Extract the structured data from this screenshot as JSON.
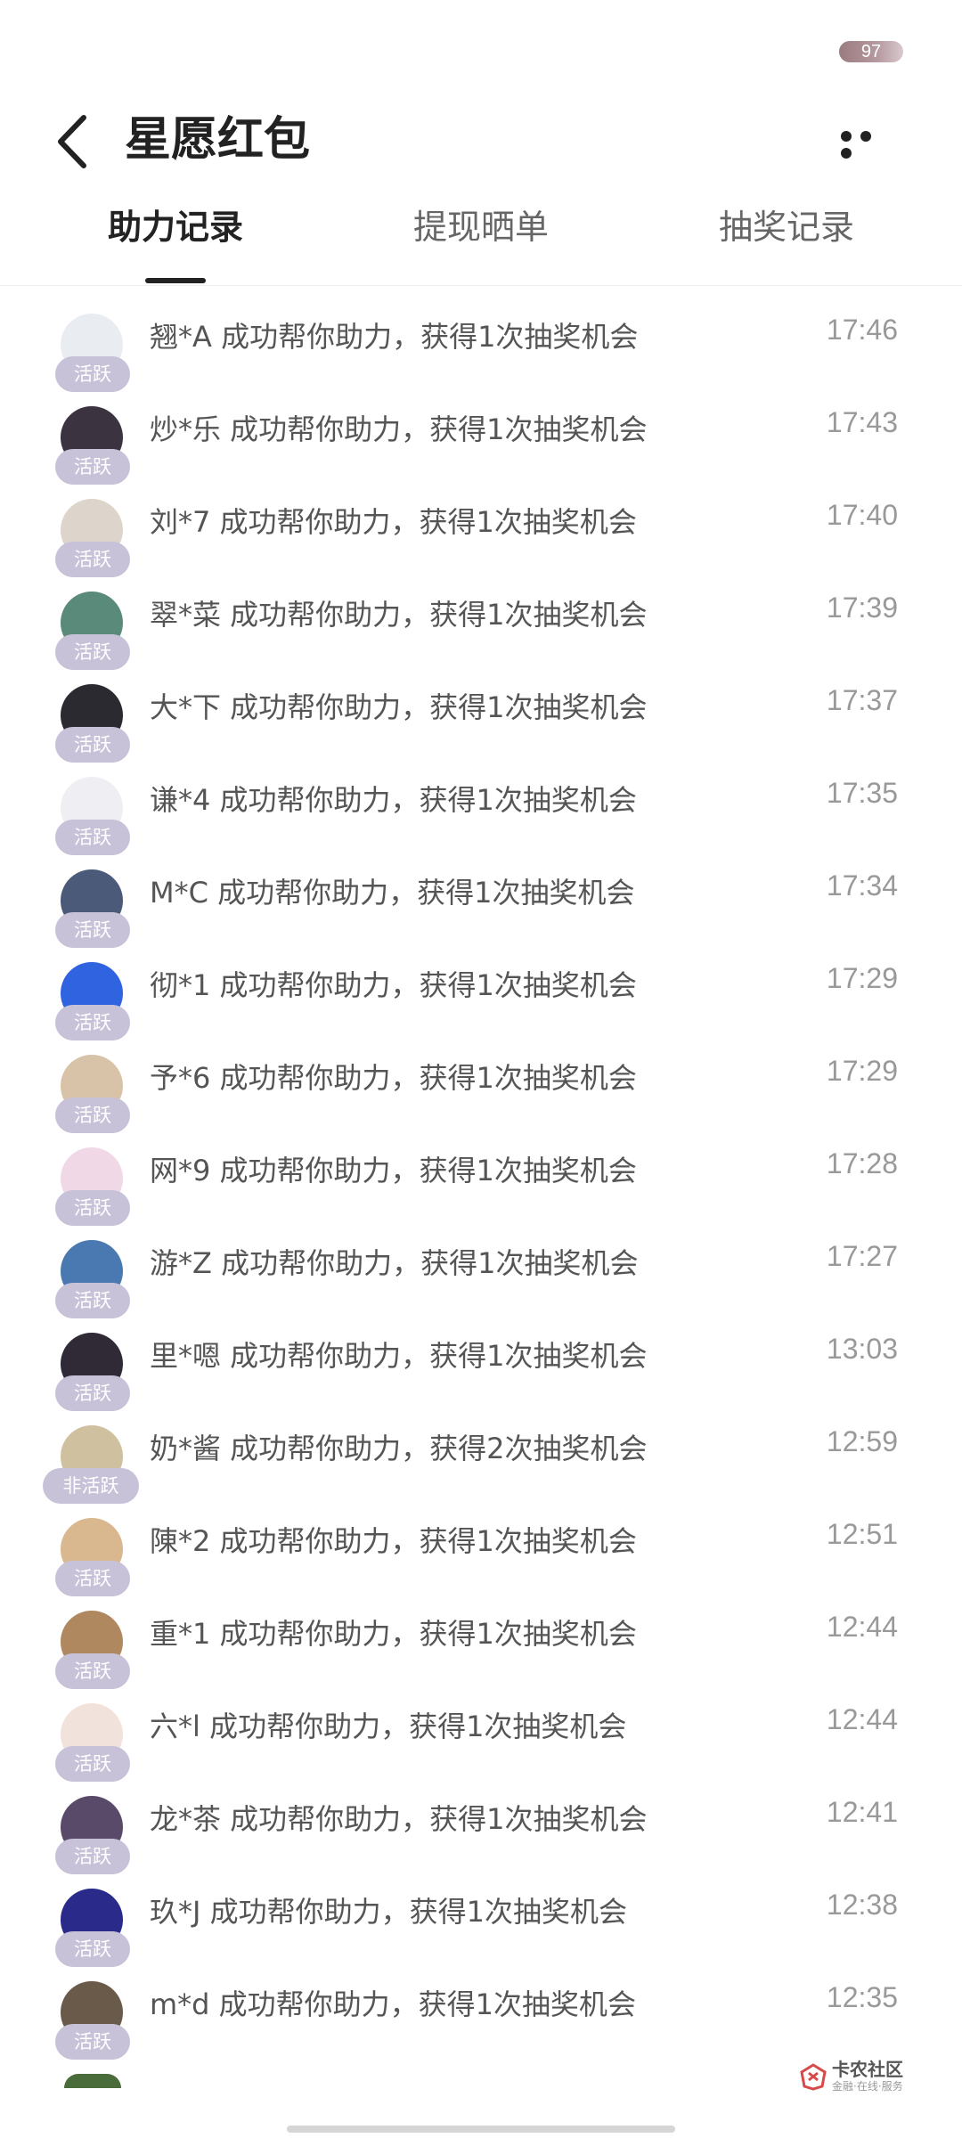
{
  "status_bar": {
    "battery": "97"
  },
  "header": {
    "title": "星愿红包"
  },
  "tabs": [
    {
      "label": "助力记录",
      "active": true
    },
    {
      "label": "提现晒单",
      "active": false
    },
    {
      "label": "抽奖记录",
      "active": false
    }
  ],
  "records": [
    {
      "text": "翘*A 成功帮你助力，获得1次抽奖机会",
      "time": "17:46",
      "badge": "活跃"
    },
    {
      "text": "炒*乐 成功帮你助力，获得1次抽奖机会",
      "time": "17:43",
      "badge": "活跃"
    },
    {
      "text": "刘*7 成功帮你助力，获得1次抽奖机会",
      "time": "17:40",
      "badge": "活跃"
    },
    {
      "text": "翠*菜 成功帮你助力，获得1次抽奖机会",
      "time": "17:39",
      "badge": "活跃"
    },
    {
      "text": "大*下 成功帮你助力，获得1次抽奖机会",
      "time": "17:37",
      "badge": "活跃"
    },
    {
      "text": "谦*4 成功帮你助力，获得1次抽奖机会",
      "time": "17:35",
      "badge": "活跃"
    },
    {
      "text": "M*C 成功帮你助力，获得1次抽奖机会",
      "time": "17:34",
      "badge": "活跃"
    },
    {
      "text": "彻*1 成功帮你助力，获得1次抽奖机会",
      "time": "17:29",
      "badge": "活跃"
    },
    {
      "text": "予*6 成功帮你助力，获得1次抽奖机会",
      "time": "17:29",
      "badge": "活跃"
    },
    {
      "text": "网*9 成功帮你助力，获得1次抽奖机会",
      "time": "17:28",
      "badge": "活跃"
    },
    {
      "text": "游*Z 成功帮你助力，获得1次抽奖机会",
      "time": "17:27",
      "badge": "活跃"
    },
    {
      "text": "里*嗯 成功帮你助力，获得1次抽奖机会",
      "time": "13:03",
      "badge": "活跃"
    },
    {
      "text": "奶*酱 成功帮你助力，获得2次抽奖机会",
      "time": "12:59",
      "badge": "非活跃"
    },
    {
      "text": "陳*2 成功帮你助力，获得1次抽奖机会",
      "time": "12:51",
      "badge": "活跃"
    },
    {
      "text": "重*1 成功帮你助力，获得1次抽奖机会",
      "time": "12:44",
      "badge": "活跃"
    },
    {
      "text": "六*l 成功帮你助力，获得1次抽奖机会",
      "time": "12:44",
      "badge": "活跃"
    },
    {
      "text": "龙*茶 成功帮你助力，获得1次抽奖机会",
      "time": "12:41",
      "badge": "活跃"
    },
    {
      "text": "玖*J 成功帮你助力，获得1次抽奖机会",
      "time": "12:38",
      "badge": "活跃"
    },
    {
      "text": "m*d 成功帮你助力，获得1次抽奖机会",
      "time": "12:35",
      "badge": "活跃"
    }
  ],
  "avatar_colors": [
    "#e9edf2",
    "#3b3340",
    "#ddd5cc",
    "#5a8a7a",
    "#2a2a30",
    "#efeef2",
    "#4a5a78",
    "#2f63e0",
    "#d8c3a8",
    "#f0d8e6",
    "#4a78b0",
    "#2f2a35",
    "#cfc0a0",
    "#d9b890",
    "#b08860",
    "#f2e2dc",
    "#5a4a6a",
    "#2a2a8a",
    "#6a5a4a"
  ],
  "watermark": {
    "name": "卡农社区",
    "sub": "金融·在线·服务"
  }
}
